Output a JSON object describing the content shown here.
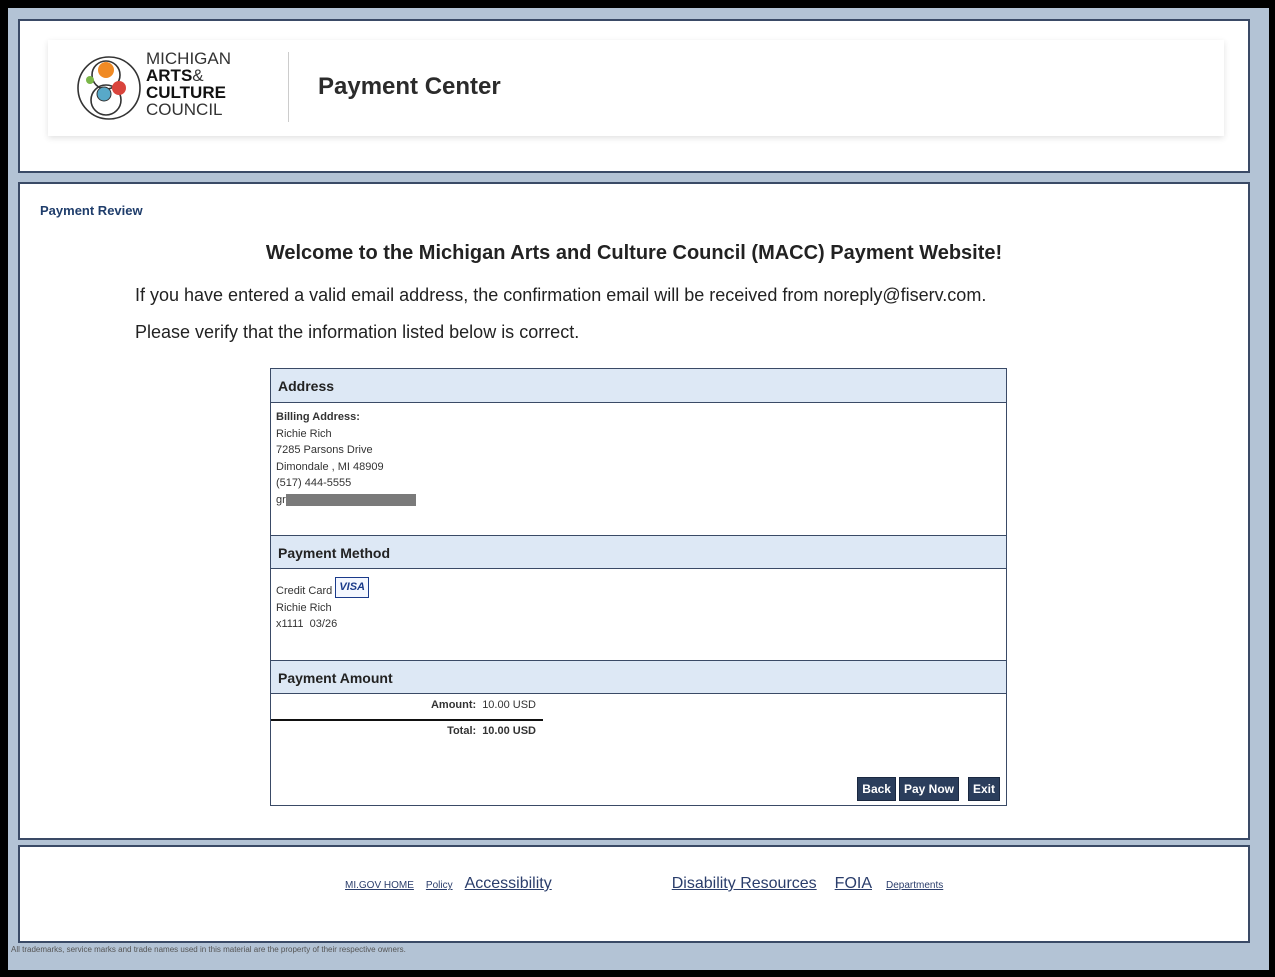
{
  "header": {
    "logo_lines": [
      "MICHIGAN",
      "ARTS",
      "&",
      "CULTURE",
      "COUNCIL"
    ],
    "app_title": "Payment Center"
  },
  "main": {
    "breadcrumb": "Payment Review",
    "welcome": "Welcome to the Michigan Arts and Culture Council (MACC) Payment Website!",
    "info_line_1": "If you have entered a valid email address, the confirmation email will be received from noreply@fiserv.com.",
    "info_line_2": "Please verify that the information listed below is correct."
  },
  "address": {
    "heading": "Address",
    "label": "Billing Address:",
    "name": "Richie Rich",
    "street": "7285 Parsons Drive",
    "city": "Dimondale , MI 48909",
    "phone": "(517) 444-5555",
    "email": "gr...@michigan.gov"
  },
  "payment_method": {
    "heading": "Payment Method",
    "type": "Credit Card",
    "card_brand": "VISA",
    "name": "Richie Rich",
    "card_last4": "x1111",
    "expiry": "03/26"
  },
  "payment_amount": {
    "heading": "Payment Amount",
    "amount_label": "Amount:",
    "amount_value": "10.00 USD",
    "total_label": "Total:",
    "total_value": "10.00 USD"
  },
  "buttons": {
    "back": "Back",
    "pay_now": "Pay Now",
    "exit": "Exit"
  },
  "footer": {
    "links": [
      "MI.GOV HOME",
      "Policy",
      "Accessibility",
      "Disability Resources",
      "FOIA",
      "Departments"
    ],
    "fine_print": "All trademarks, service marks and trade names used in this material are the property of their respective owners."
  },
  "colors": {
    "frame_bg": "#b3c3d5",
    "border": "#3a4a66",
    "section_header_bg": "#dde8f5",
    "button_bg": "#2b3e5c",
    "logo_orange": "#f08a24",
    "logo_green": "#7ab648",
    "logo_red": "#d9443c",
    "logo_blue": "#58a9c9"
  }
}
